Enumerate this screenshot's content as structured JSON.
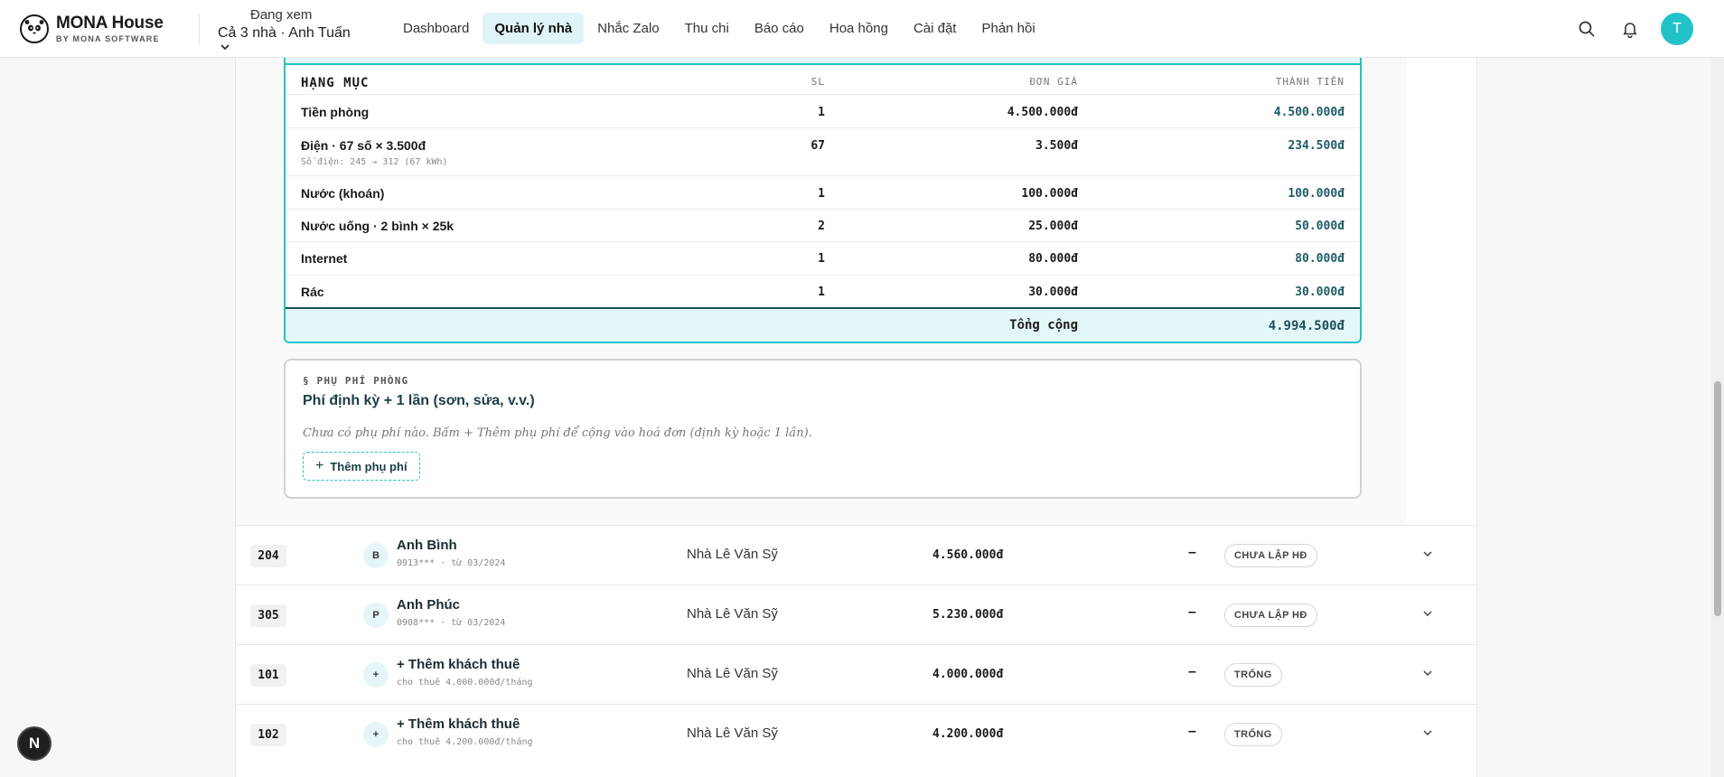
{
  "brand": {
    "name": "MONA House",
    "sub": "BY MONA SOFTWARE"
  },
  "scope": {
    "label": "Đang xem",
    "value": "Cả 3 nhà · Anh Tuấn"
  },
  "nav": [
    {
      "label": "Dashboard"
    },
    {
      "label": "Quản lý nhà",
      "active": true
    },
    {
      "label": "Nhắc Zalo"
    },
    {
      "label": "Thu chi"
    },
    {
      "label": "Báo cáo"
    },
    {
      "label": "Hoa hồng"
    },
    {
      "label": "Cài đặt"
    },
    {
      "label": "Phản hồi"
    }
  ],
  "user": {
    "initial": "T"
  },
  "invoice": {
    "headers": {
      "item": "HẠNG MỤC",
      "qty": "SL",
      "price": "ĐƠN GIÁ",
      "total": "THÀNH TIỀN"
    },
    "rows": [
      {
        "item": "Tiền phòng",
        "note": "",
        "qty": "1",
        "price": "4.500.000đ",
        "total": "4.500.000đ"
      },
      {
        "item": "Điện · 67 số × 3.500đ",
        "note": "Số điện: 245 → 312 (67 kWh)",
        "qty": "67",
        "price": "3.500đ",
        "total": "234.500đ"
      },
      {
        "item": "Nước (khoán)",
        "note": "",
        "qty": "1",
        "price": "100.000đ",
        "total": "100.000đ"
      },
      {
        "item": "Nước uống · 2 bình × 25k",
        "note": "",
        "qty": "2",
        "price": "25.000đ",
        "total": "50.000đ"
      },
      {
        "item": "Internet",
        "note": "",
        "qty": "1",
        "price": "80.000đ",
        "total": "80.000đ"
      },
      {
        "item": "Rác",
        "note": "",
        "qty": "1",
        "price": "30.000đ",
        "total": "30.000đ"
      }
    ],
    "total_label": "Tổng cộng",
    "total_value": "4.994.500đ"
  },
  "surcharge": {
    "kicker": "§ PHỤ PHÍ PHÒNG",
    "title": "Phí định kỳ + 1 lần (sơn, sửa, v.v.)",
    "desc": "Chưa có phụ phí nào. Bấm + Thêm phụ phí để cộng vào hoá đơn (định kỳ hoặc 1 lần).",
    "button": "Thêm phụ phí"
  },
  "rooms": [
    {
      "no": "204",
      "avatar": "B",
      "name": "Anh Bình",
      "sub": "0913*** · từ 03/2024",
      "house": "Nhà Lê Văn Sỹ",
      "rent": "4.560.000đ",
      "dash": "–",
      "status": "CHƯA LẬP HĐ"
    },
    {
      "no": "305",
      "avatar": "P",
      "name": "Anh Phúc",
      "sub": "0908*** · từ 03/2024",
      "house": "Nhà Lê Văn Sỹ",
      "rent": "5.230.000đ",
      "dash": "–",
      "status": "CHƯA LẬP HĐ"
    },
    {
      "no": "101",
      "avatar": "+",
      "name": "+ Thêm khách thuê",
      "sub": "cho thuê 4.000.000đ/tháng",
      "house": "Nhà Lê Văn Sỹ",
      "rent": "4.000.000đ",
      "dash": "–",
      "status": "TRỐNG"
    },
    {
      "no": "102",
      "avatar": "+",
      "name": "+ Thêm khách thuê",
      "sub": "cho thuê 4.200.000đ/tháng",
      "house": "Nhà Lê Văn Sỹ",
      "rent": "4.200.000đ",
      "dash": "–",
      "status": "TRỐNG"
    }
  ],
  "fab": {
    "label": "N"
  },
  "colors": {
    "accent": "#22c3c8",
    "accent_soft": "#e3f7f8",
    "dark_teal": "#1c5c66"
  }
}
